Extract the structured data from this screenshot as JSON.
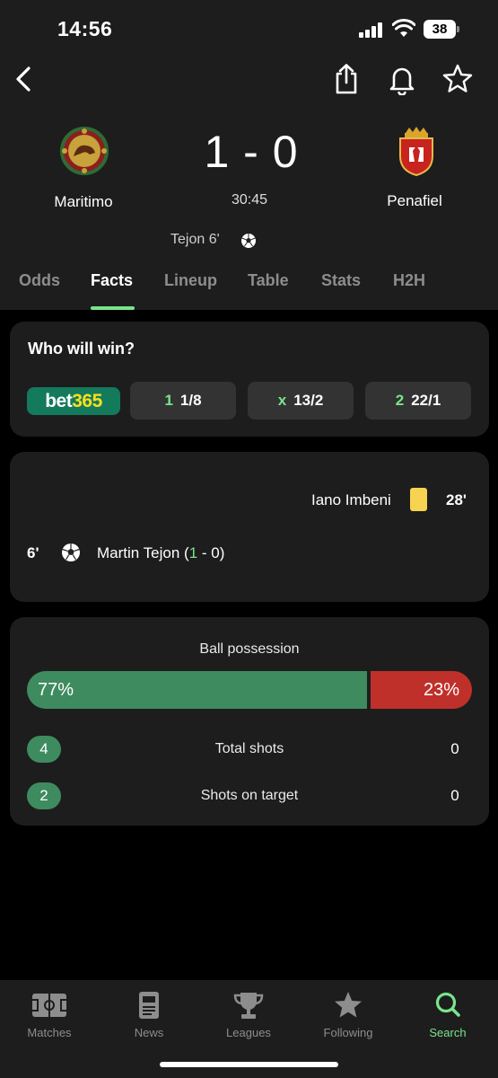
{
  "status_bar": {
    "time": "14:56",
    "battery": "38"
  },
  "match": {
    "home_team": "Maritimo",
    "away_team": "Penafiel",
    "score": "1 - 0",
    "clock": "30:45",
    "scorer_summary": "Tejon 6'"
  },
  "tabs": [
    {
      "label": "Odds"
    },
    {
      "label": "Facts"
    },
    {
      "label": "Lineup"
    },
    {
      "label": "Table"
    },
    {
      "label": "Stats"
    },
    {
      "label": "H2H"
    }
  ],
  "odds_card": {
    "title": "Who will win?",
    "bookmaker_prefix": "bet",
    "bookmaker_suffix": "365",
    "options": [
      {
        "label": "1",
        "value": "1/8"
      },
      {
        "label": "x",
        "value": "13/2"
      },
      {
        "label": "2",
        "value": "22/1"
      }
    ]
  },
  "events": {
    "card_event": {
      "player": "Iano Imbeni",
      "minute": "28'"
    },
    "goal_event": {
      "minute": "6'",
      "player": "Martin Tejon",
      "score_open": "(",
      "score_home": "1",
      "score_rest": " - 0)"
    }
  },
  "stats": {
    "possession_title": "Ball possession",
    "possession_home": 77,
    "possession_home_label": "77%",
    "possession_away_label": "23%",
    "rows": [
      {
        "home": "4",
        "label": "Total shots",
        "away": "0"
      },
      {
        "home": "2",
        "label": "Shots on target",
        "away": "0"
      }
    ]
  },
  "bottom_nav": [
    {
      "label": "Matches"
    },
    {
      "label": "News"
    },
    {
      "label": "Leagues"
    },
    {
      "label": "Following"
    },
    {
      "label": "Search"
    }
  ],
  "colors": {
    "accent": "#7ae48b",
    "home": "#3e8b5f",
    "away": "#c0302a",
    "card": "#1d1d1d"
  }
}
